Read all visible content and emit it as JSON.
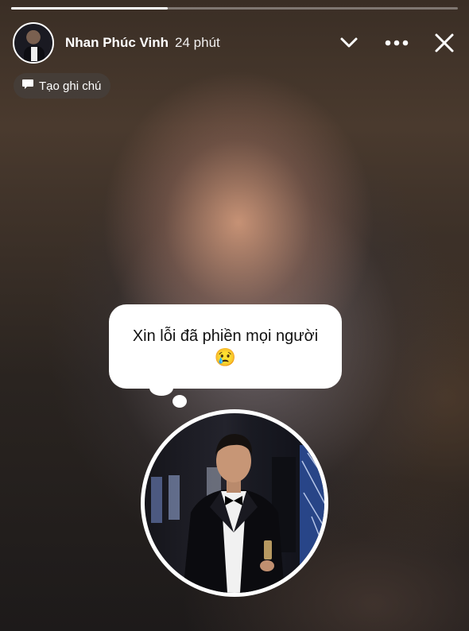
{
  "story": {
    "progress": 0.35,
    "user_name": "Nhan Phúc Vinh",
    "time_ago": "24 phút",
    "icons": {
      "collapse": "chevron-down-icon",
      "more": "more-icon",
      "close": "close-icon"
    }
  },
  "note_chip": {
    "label": "Tạo ghi chú",
    "icon": "note-bubble-icon"
  },
  "note": {
    "text": "Xin lỗi đã phiền mọi người",
    "emoji": "😢"
  },
  "colors": {
    "text": "#ffffff",
    "bubble": "#ffffff",
    "accent_blue": "#3b6fd8"
  }
}
